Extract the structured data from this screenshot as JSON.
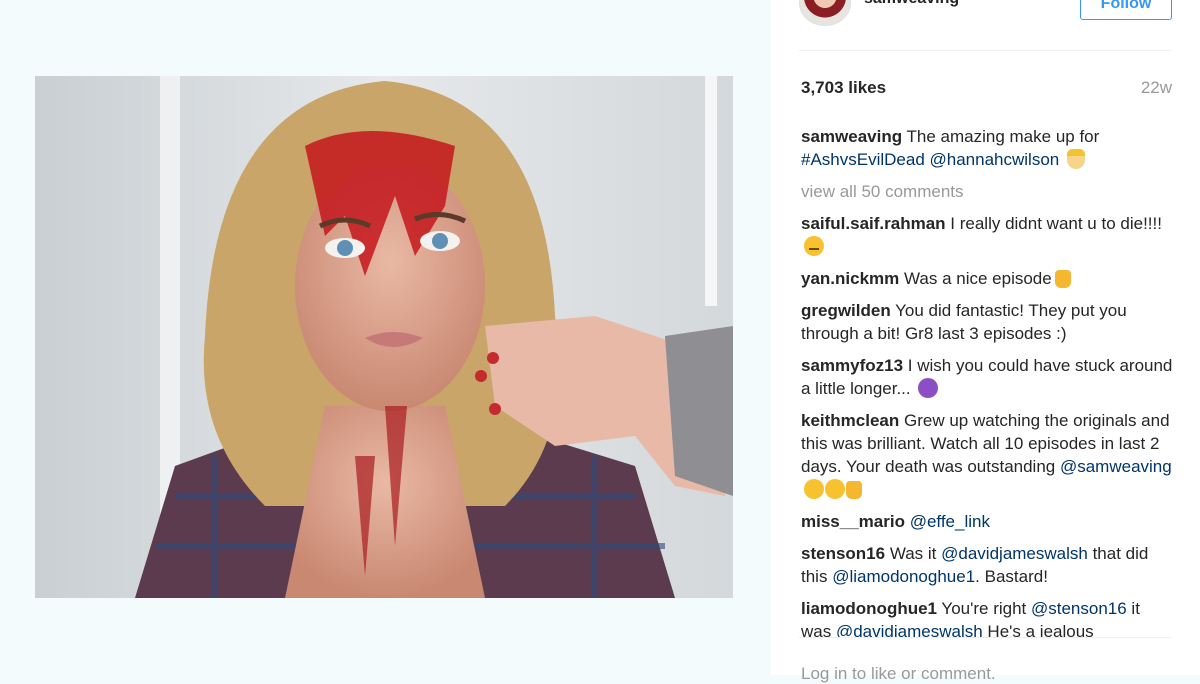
{
  "post": {
    "username": "samweaving",
    "follow_label": "Follow",
    "likes": "3,703 likes",
    "age": "22w",
    "caption": {
      "user": "samweaving",
      "text": " The amazing make up for ",
      "hashtag": "#AshvsEvilDead",
      "mention": "@hannahcwilson",
      "emoji": "princess-emoji"
    },
    "view_all": "view all 50 comments",
    "comments": [
      {
        "user": "saiful.saif.rahman",
        "text": " I really didnt want u to die!!!! ",
        "emoji": "expressionless-emoji"
      },
      {
        "user": "yan.nickmm",
        "text": " Was a nice episode",
        "emoji": "thumbs-up-emoji"
      },
      {
        "user": "gregwilden",
        "text": " You did fantastic! They put you through a bit! Gr8 last 3 episodes :)"
      },
      {
        "user": "sammyfoz13",
        "text": " I wish you could have stuck around a little longer... ",
        "emoji": "devil-emoji"
      },
      {
        "user": "keithmclean",
        "text": " Grew up watching the originals and this was brilliant. Watch all 10 episodes in last 2 days. Your death was outstanding ",
        "mention": "@samweaving",
        "emoji": "joy-emoji"
      },
      {
        "user": "miss__mario",
        "text": " ",
        "mention": "@effe_link"
      },
      {
        "user": "stenson16",
        "text_before": " Was it ",
        "mention": "@davidjameswalsh",
        "text_mid": " that did this ",
        "mention2": "@liamodonoghue1",
        "text_after": ". Bastard!"
      },
      {
        "user": "liamodonoghue1",
        "text_before": " You're right ",
        "mention": "@stenson16",
        "text_mid": " it was ",
        "mention2": "@davidjameswalsh",
        "text_after": " He's a jealous"
      }
    ],
    "bottom_text": "Log in to like or comment."
  },
  "colors": {
    "link": "#003569",
    "follow_blue": "#3897f0",
    "muted": "#999999"
  }
}
